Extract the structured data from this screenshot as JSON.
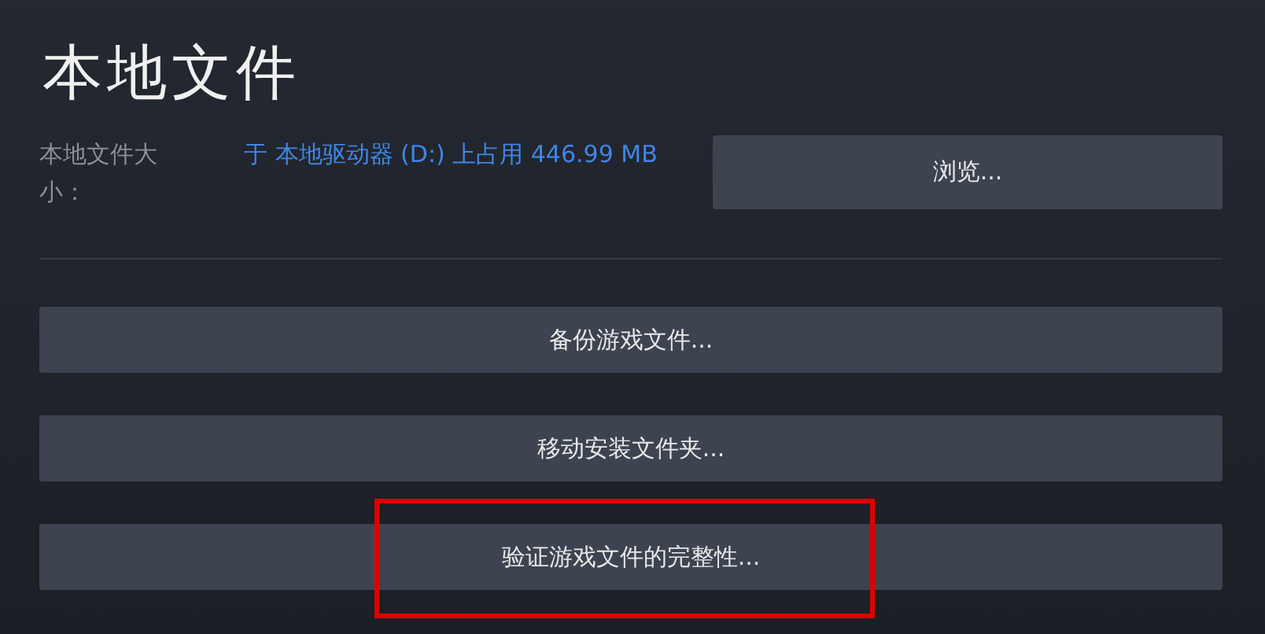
{
  "title": "本地文件",
  "size": {
    "label": "本地文件大小：",
    "value": "于 本地驱动器 (D:) 上占用 446.99 MB"
  },
  "browse_button": "浏览...",
  "actions": [
    {
      "label": "备份游戏文件...",
      "highlighted": false
    },
    {
      "label": "移动安装文件夹...",
      "highlighted": false
    },
    {
      "label": "验证游戏文件的完整性...",
      "highlighted": true
    }
  ]
}
